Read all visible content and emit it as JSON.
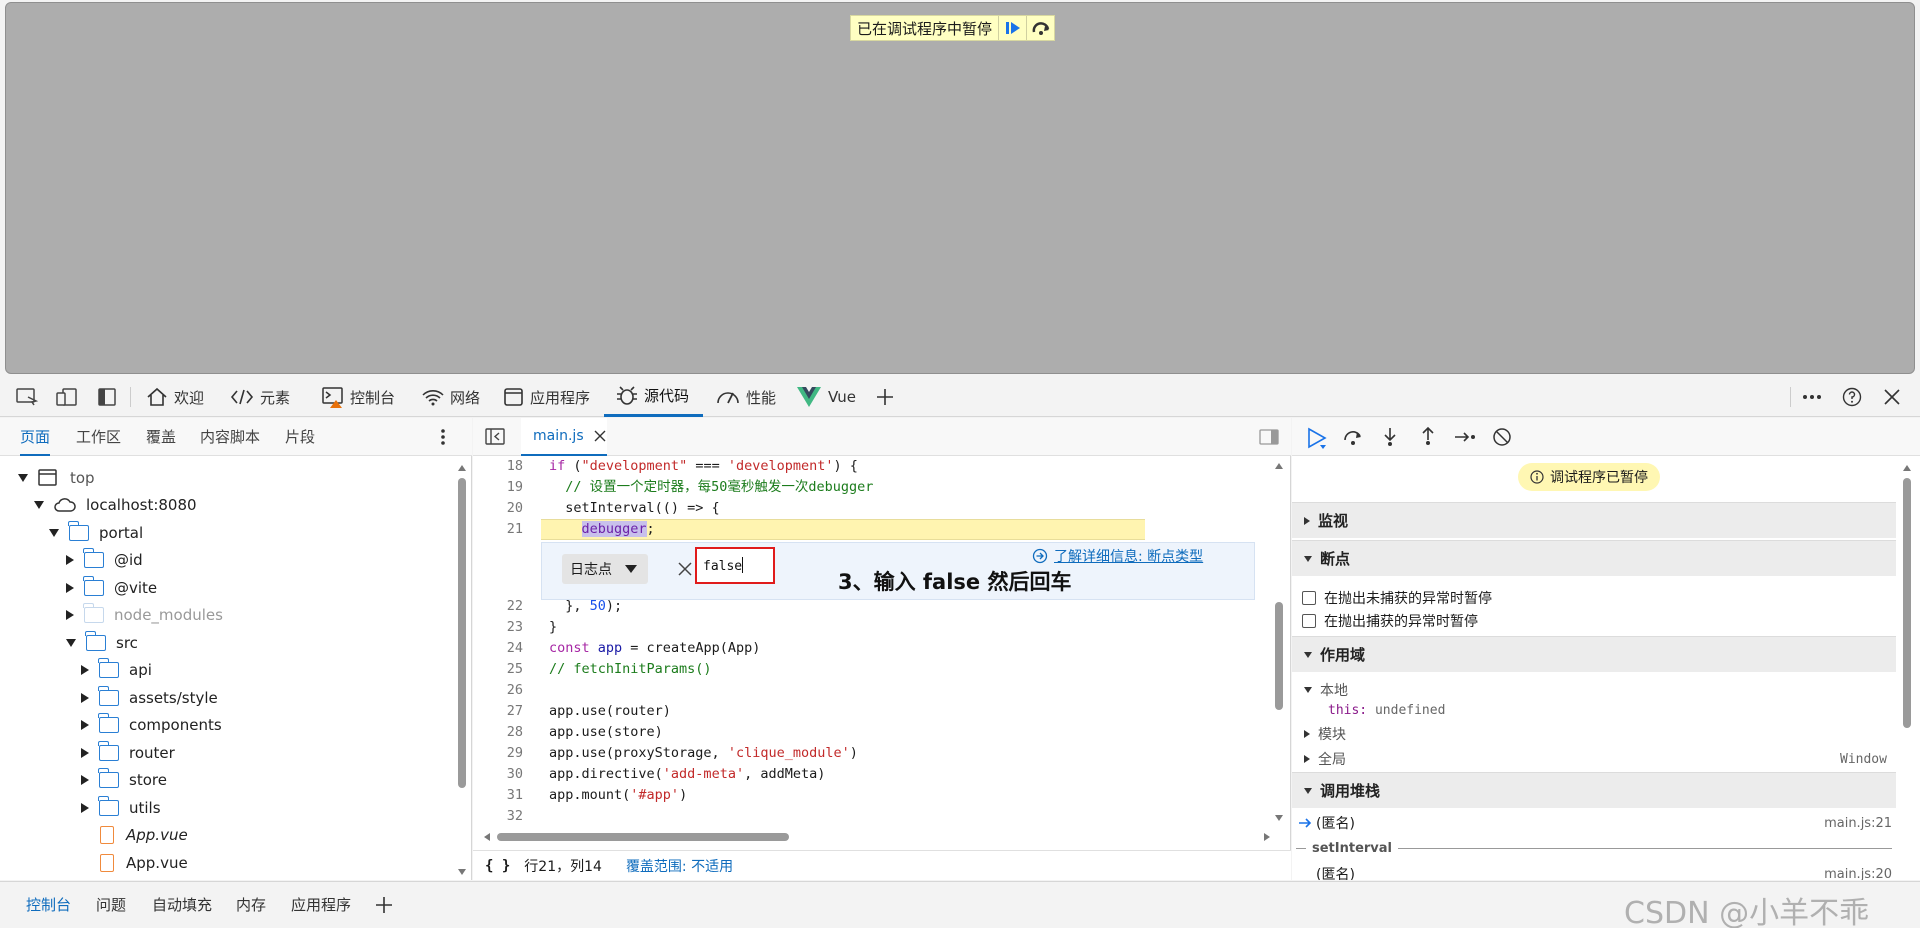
{
  "viewport": {
    "banner_text": "已在调试程序中暂停"
  },
  "toolbar": {
    "tabs": [
      {
        "label": "欢迎"
      },
      {
        "label": "元素"
      },
      {
        "label": "控制台"
      },
      {
        "label": "网络"
      },
      {
        "label": "应用程序"
      },
      {
        "label": "源代码"
      },
      {
        "label": "性能"
      },
      {
        "label": "Vue"
      }
    ]
  },
  "left_panel": {
    "tabs": [
      "页面",
      "工作区",
      "覆盖",
      "内容脚本",
      "片段"
    ],
    "tree": [
      {
        "label": "top"
      },
      {
        "label": "localhost:8080"
      },
      {
        "label": "portal"
      },
      {
        "label": "@id"
      },
      {
        "label": "@vite"
      },
      {
        "label": "node_modules"
      },
      {
        "label": "src"
      },
      {
        "label": "api"
      },
      {
        "label": "assets/style"
      },
      {
        "label": "components"
      },
      {
        "label": "router"
      },
      {
        "label": "store"
      },
      {
        "label": "utils"
      },
      {
        "label": "App.vue"
      },
      {
        "label": "App.vue"
      }
    ]
  },
  "editor": {
    "file_tab": "main.js",
    "lines": [
      {
        "n": "18",
        "text": "if (\"development\" === 'development') {"
      },
      {
        "n": "19",
        "text": "  // 设置一个定时器，每50毫秒触发一次debugger"
      },
      {
        "n": "20",
        "text": "  setInterval(() => {"
      },
      {
        "n": "21",
        "text": "    debugger;"
      },
      {
        "n": "22",
        "text": "  }, 50);"
      },
      {
        "n": "23",
        "text": "}"
      },
      {
        "n": "24",
        "text": "const app = createApp(App)"
      },
      {
        "n": "25",
        "text": "// fetchInitParams()"
      },
      {
        "n": "26",
        "text": ""
      },
      {
        "n": "27",
        "text": "app.use(router)"
      },
      {
        "n": "28",
        "text": "app.use(store)"
      },
      {
        "n": "29",
        "text": "app.use(proxyStorage, 'clique_module')"
      },
      {
        "n": "30",
        "text": "app.directive('add-meta', addMeta)"
      },
      {
        "n": "31",
        "text": "app.mount('#app')"
      },
      {
        "n": "32",
        "text": ""
      }
    ],
    "breakpoint_editor": {
      "type_select": "日志点",
      "input_value": "false",
      "learn_more": "了解详细信息: 断点类型"
    },
    "annotation": "3、输入 false 然后回车",
    "status": {
      "format_label": "{ }",
      "position": "行21，列14",
      "coverage": "覆盖范围: 不适用"
    }
  },
  "right_panel": {
    "paused_badge": "调试程序已暂停",
    "watch": "监视",
    "breakpoints": "断点",
    "bp_uncaught": "在抛出未捕获的异常时暂停",
    "bp_caught": "在抛出捕获的异常时暂停",
    "scope": "作用域",
    "scope_local": "本地",
    "this_key": "this:",
    "this_val": "undefined",
    "scope_module": "模块",
    "scope_global": "全局",
    "global_val": "Window",
    "callstack": "调用堆栈",
    "frame1_name": "(匿名)",
    "frame1_loc": "main.js:21",
    "async_label": "setInterval",
    "frame2_name": "(匿名)",
    "frame2_loc": "main.js:20"
  },
  "bottom_tabs": [
    "控制台",
    "问题",
    "自动填充",
    "内存",
    "应用程序"
  ],
  "watermark": "CSDN @小羊不乖"
}
